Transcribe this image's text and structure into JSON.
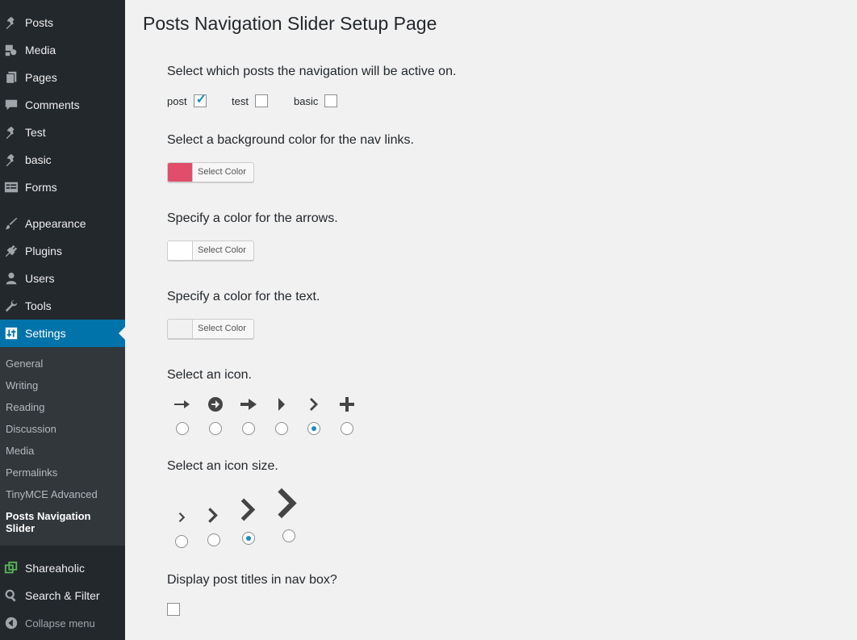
{
  "sidebar": {
    "items": [
      {
        "label": "Posts",
        "icon": "pin-icon"
      },
      {
        "label": "Media",
        "icon": "media-icon"
      },
      {
        "label": "Pages",
        "icon": "pages-icon"
      },
      {
        "label": "Comments",
        "icon": "comment-icon"
      },
      {
        "label": "Test",
        "icon": "pin-icon"
      },
      {
        "label": "basic",
        "icon": "pin-icon"
      },
      {
        "label": "Forms",
        "icon": "forms-icon"
      },
      {
        "label": "Appearance",
        "icon": "brush-icon"
      },
      {
        "label": "Plugins",
        "icon": "plug-icon"
      },
      {
        "label": "Users",
        "icon": "user-icon"
      },
      {
        "label": "Tools",
        "icon": "wrench-icon"
      },
      {
        "label": "Settings",
        "icon": "settings-icon"
      }
    ],
    "submenu": [
      "General",
      "Writing",
      "Reading",
      "Discussion",
      "Media",
      "Permalinks",
      "TinyMCE Advanced",
      "Posts Navigation Slider"
    ],
    "bottom_items": [
      {
        "label": "Shareaholic",
        "icon": "shareaholic-icon"
      },
      {
        "label": "Search & Filter",
        "icon": "search-icon"
      },
      {
        "label": "Collapse menu",
        "icon": "collapse-icon"
      }
    ]
  },
  "main": {
    "title": "Posts Navigation Slider Setup Page",
    "post_types_label": "Select which posts the navigation will be active on.",
    "post_types": [
      {
        "label": "post",
        "checked": true
      },
      {
        "label": "test",
        "checked": false
      },
      {
        "label": "basic",
        "checked": false
      }
    ],
    "bg_color_label": "Select a background color for the nav links.",
    "bg_color": "#e14d6a",
    "arrow_color_label": "Specify a color for the arrows.",
    "arrow_color": "#ffffff",
    "text_color_label": "Specify a color for the text.",
    "text_color": "#f1f1f1",
    "select_color_label": "Select Color",
    "icon_label": "Select an icon.",
    "icons": [
      "arrow-right-icon",
      "circle-arrow-icon",
      "bold-arrow-icon",
      "triangle-icon",
      "chevron-right-icon",
      "plus-icon"
    ],
    "icon_selected": 4,
    "icon_size_label": "Select an icon size.",
    "icon_size_selected": 2,
    "titles_label": "Display post titles in nav box?",
    "titles_checked": false
  }
}
